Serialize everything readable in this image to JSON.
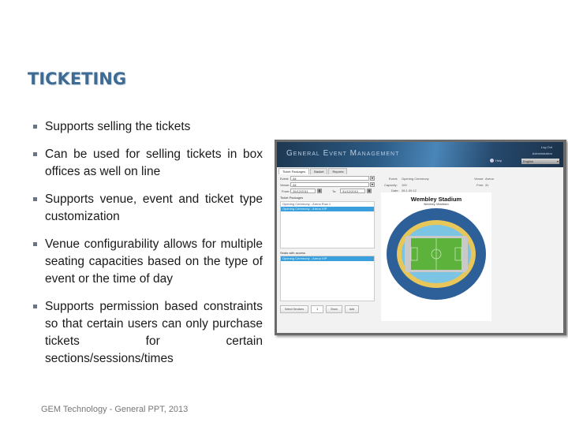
{
  "slide": {
    "title": "TICKETING",
    "bullets": [
      "Supports selling the tickets",
      "Can be used for selling tickets in box offices as well on line",
      "Supports venue, event and ticket type customization",
      "Venue configurability allows for multiple seating capacities based on the type of event or the time of day",
      "Supports permission based constraints so that certain users can only purchase tickets for certain sections/sessions/times"
    ],
    "footer": "GEM Technology - General PPT, 2013"
  },
  "app": {
    "title": "General Event Management",
    "header_links": [
      "Log Out",
      "Administration"
    ],
    "help_label": "Help",
    "language": "English",
    "tabs": [
      "Ticket Packages",
      "Basket",
      "Reports"
    ],
    "form": {
      "event_label": "Event:",
      "event_value": "All",
      "venue_label": "Venue:",
      "venue_value": "All",
      "from_label": "From:",
      "from_value": "26/12/2011",
      "to_label": "To:",
      "to_value": "31/12/2012"
    },
    "ticket_packages_title": "Ticket Packages",
    "ticket_packages": [
      {
        "label": "Opening Ceremony - Arena Row 1",
        "selected": false
      },
      {
        "label": "Opening Ceremony - Arena VIP",
        "selected": true
      }
    ],
    "seats_title": "Seats with access",
    "seats": [
      {
        "label": "Opening Ceremony - Arena VIP",
        "selected": true
      }
    ],
    "details": {
      "event_label": "Event:",
      "event_value": "Opening Ceremony",
      "venue_label": "Venue:",
      "venue_value": "Arena",
      "capacity_label": "Capacity:",
      "capacity_value": "100",
      "free_label": "Free:",
      "free_value": "31",
      "date_label": "Date:",
      "date_value": "26.1.09.12"
    },
    "map": {
      "title": "Wembley Stadium",
      "subtitle": "Wembley, Middlesex",
      "colors": {
        "outer": "#2d5f98",
        "ring": "#e8c75a",
        "inner": "#7cc4e4",
        "pitch": "#5cb23a",
        "concourse": "#c9c9c9"
      }
    },
    "buttons": {
      "select_sections": "Select Sections",
      "quantity": "1",
      "show": "Show",
      "add": "Add"
    }
  }
}
